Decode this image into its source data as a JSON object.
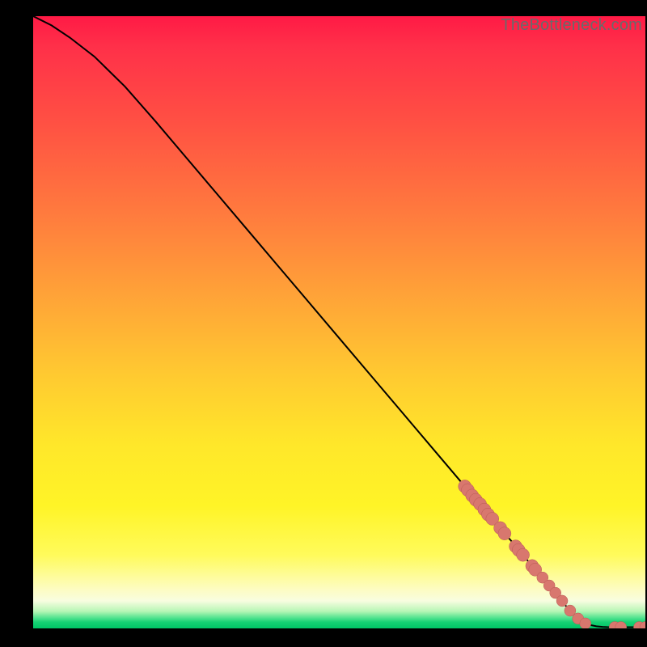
{
  "watermark": "TheBottleneck.com",
  "colors": {
    "curve": "#000000",
    "marker_fill": "#d8776e",
    "marker_stroke": "#b85a53"
  },
  "chart_data": {
    "type": "line",
    "title": "",
    "xlabel": "",
    "ylabel": "",
    "xlim": [
      0,
      100
    ],
    "ylim": [
      0,
      100
    ],
    "series": [
      {
        "name": "bottleneck-curve",
        "x": [
          0,
          3,
          6,
          10,
          15,
          20,
          25,
          30,
          35,
          40,
          45,
          50,
          55,
          60,
          65,
          70,
          71,
          72,
          73,
          74,
          75,
          76,
          77,
          78,
          79,
          80,
          81,
          82,
          83,
          84,
          85,
          86,
          87,
          88,
          89,
          90,
          91,
          92,
          93,
          94,
          95,
          96,
          97,
          98,
          99,
          100
        ],
        "y": [
          100,
          98.5,
          96.5,
          93.4,
          88.5,
          82.8,
          76.9,
          71.0,
          65.1,
          59.2,
          53.3,
          47.4,
          41.5,
          35.6,
          29.7,
          23.8,
          22.6,
          21.4,
          20.3,
          19.1,
          17.9,
          16.7,
          15.5,
          14.4,
          13.2,
          12.0,
          10.8,
          9.6,
          8.5,
          7.3,
          6.1,
          4.9,
          3.7,
          2.6,
          1.6,
          0.9,
          0.55,
          0.35,
          0.25,
          0.2,
          0.2,
          0.2,
          0.2,
          0.2,
          0.2,
          0.2
        ]
      }
    ],
    "markers": {
      "name": "highlighted-points",
      "x": [
        70.5,
        71,
        71.7,
        72.3,
        73,
        73.7,
        74.3,
        75,
        76.3,
        77,
        78.8,
        79.3,
        80,
        81.5,
        82,
        83.2,
        84.3,
        85.3,
        86.4,
        87.7,
        89,
        90.2,
        95,
        96,
        99,
        100
      ],
      "y": [
        23.2,
        22.6,
        21.7,
        21.0,
        20.3,
        19.4,
        18.6,
        17.9,
        16.4,
        15.5,
        13.4,
        12.8,
        12.0,
        10.2,
        9.6,
        8.3,
        7.0,
        5.8,
        4.5,
        2.9,
        1.6,
        0.8,
        0.2,
        0.2,
        0.2,
        0.2
      ],
      "r": [
        8,
        8,
        8,
        8,
        8,
        8,
        8,
        8,
        8,
        8,
        8,
        8,
        8,
        8,
        8,
        7,
        7,
        7,
        7,
        7,
        7,
        7,
        7,
        7,
        7,
        7
      ]
    }
  }
}
